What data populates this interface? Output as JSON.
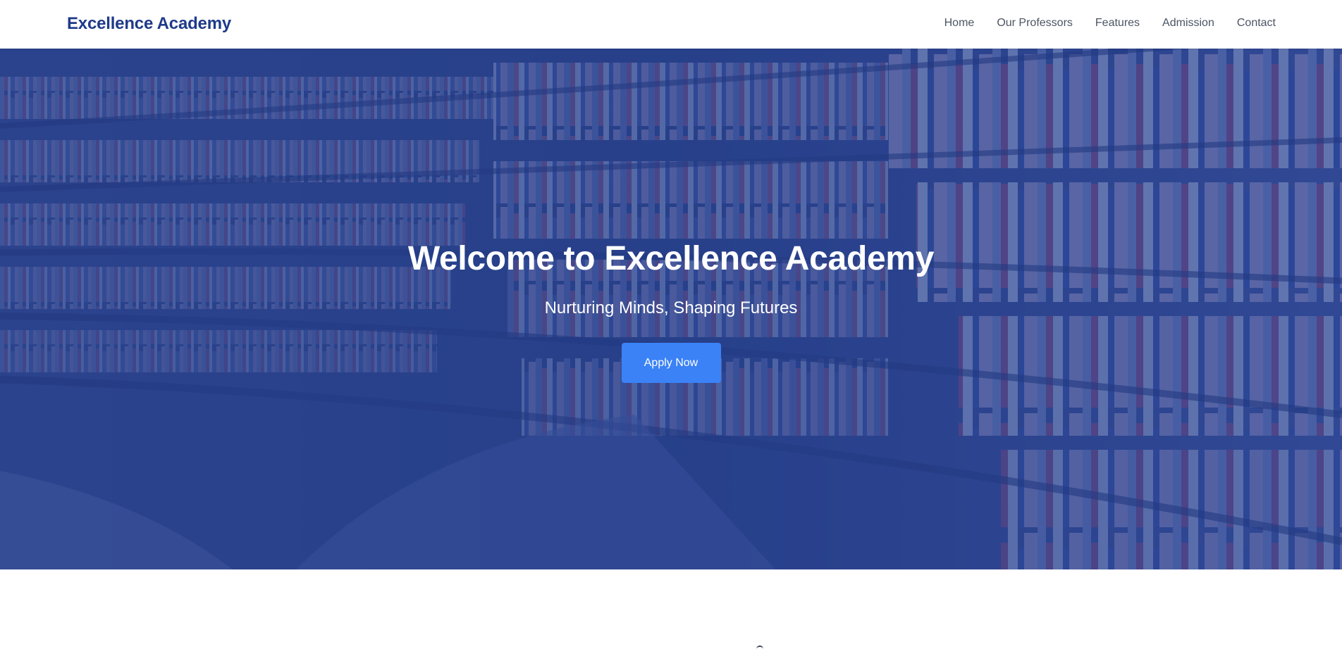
{
  "header": {
    "brand": "Excellence Academy",
    "nav": [
      "Home",
      "Our Professors",
      "Features",
      "Admission",
      "Contact"
    ]
  },
  "hero": {
    "title": "Welcome to Excellence Academy",
    "subtitle": "Nurturing Minds, Shaping Futures",
    "cta_label": "Apply Now",
    "background_image": "library-bookshelves-photo"
  },
  "colors": {
    "brand": "#1e3a8a",
    "nav_text": "#4b5563",
    "overlay": "#1e3a8a",
    "cta": "#3b82f6",
    "hero_text": "#ffffff"
  }
}
